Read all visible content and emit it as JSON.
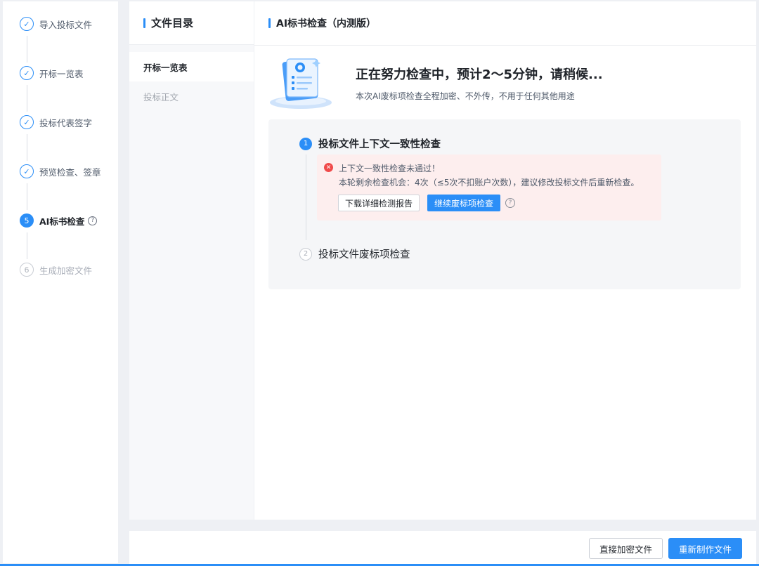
{
  "steps": [
    {
      "num": "✓",
      "label": "导入投标文件",
      "state": "done"
    },
    {
      "num": "✓",
      "label": "开标一览表",
      "state": "done"
    },
    {
      "num": "✓",
      "label": "投标代表签字",
      "state": "done"
    },
    {
      "num": "✓",
      "label": "预览检查、签章",
      "state": "done"
    },
    {
      "num": "5",
      "label": "AI标书检查",
      "state": "active"
    },
    {
      "num": "6",
      "label": "生成加密文件",
      "state": "pending"
    }
  ],
  "directory": {
    "title": "文件目录",
    "items": [
      "开标一览表",
      "投标正文"
    ]
  },
  "main": {
    "title": "AI标书检查（内测版）",
    "hero_title": "正在努力检查中，预计2～5分钟，请稍候...",
    "hero_subtitle": "本次AI废标项检查全程加密、不外传，不用于任何其他用途"
  },
  "checks": [
    {
      "num": "1",
      "title": "投标文件上下文一致性检查"
    },
    {
      "num": "2",
      "title": "投标文件废标项检查"
    }
  ],
  "alert": {
    "title": "上下文一致性检查未通过！",
    "description": "本轮剩余检查机会：4次（≤5次不扣账户次数），建议修改投标文件后重新检查。",
    "download_label": "下载详细检测报告",
    "continue_label": "继续废标项检查"
  },
  "footer": {
    "encrypt_label": "直接加密文件",
    "remake_label": "重新制作文件"
  },
  "colors": {
    "accent": "#2b8ef7",
    "error": "#f04a4a",
    "alert_bg": "#fdeeee"
  },
  "icons": {
    "done": "check-circle-icon",
    "help": "question-circle-icon",
    "error": "error-circle-icon"
  }
}
